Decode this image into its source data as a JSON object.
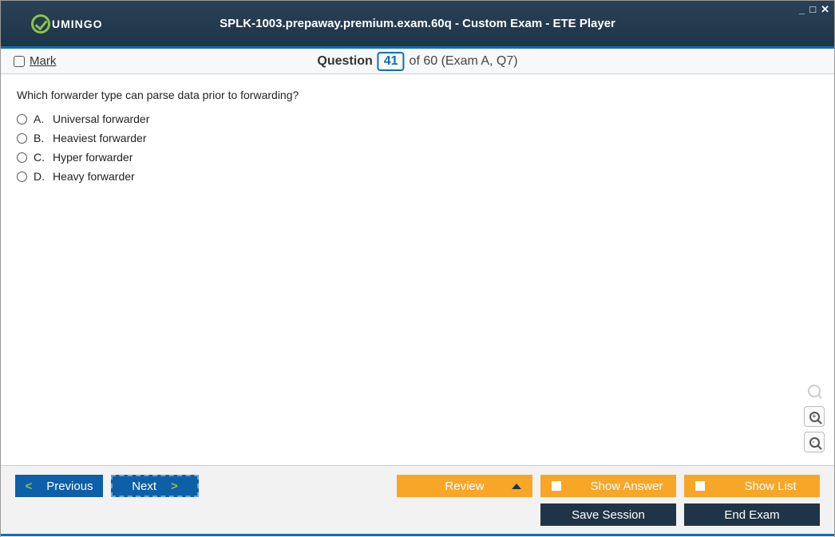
{
  "header": {
    "logo_text": "UMINGO",
    "title": "SPLK-1003.prepaway.premium.exam.60q - Custom Exam - ETE Player"
  },
  "win": {
    "min": "_",
    "max": "□",
    "close": "✕"
  },
  "qbar": {
    "mark_label": "Mark",
    "question_word": "Question",
    "current": "41",
    "of_text": "of 60 (Exam A, Q7)"
  },
  "content": {
    "question": "Which forwarder type can parse data prior to forwarding?",
    "options": [
      {
        "letter": "A.",
        "text": "Universal forwarder"
      },
      {
        "letter": "B.",
        "text": "Heaviest forwarder"
      },
      {
        "letter": "C.",
        "text": "Hyper forwarder"
      },
      {
        "letter": "D.",
        "text": "Heavy forwarder"
      }
    ]
  },
  "footer": {
    "previous": "Previous",
    "next": "Next",
    "review": "Review",
    "show_answer": "Show Answer",
    "show_list": "Show List",
    "save_session": "Save Session",
    "end_exam": "End Exam"
  }
}
